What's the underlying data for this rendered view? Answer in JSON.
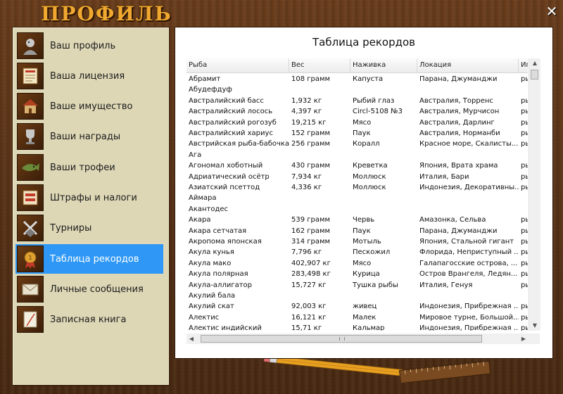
{
  "window": {
    "title": "ПРОФИЛЬ",
    "close_glyph": "✕"
  },
  "sidebar": {
    "items": [
      {
        "label": "Ваш профиль",
        "icon": "profile-icon",
        "active": false
      },
      {
        "label": "Ваша лицензия",
        "icon": "license-icon",
        "active": false
      },
      {
        "label": "Ваше имущество",
        "icon": "property-icon",
        "active": false
      },
      {
        "label": "Ваши награды",
        "icon": "awards-icon",
        "active": false
      },
      {
        "label": "Ваши трофеи",
        "icon": "trophies-icon",
        "active": false
      },
      {
        "label": "Штрафы и налоги",
        "icon": "fines-icon",
        "active": false
      },
      {
        "label": "Турниры",
        "icon": "tournaments-icon",
        "active": false
      },
      {
        "label": "Таблица рекордов",
        "icon": "records-icon",
        "active": true
      },
      {
        "label": "Личные сообщения",
        "icon": "messages-icon",
        "active": false
      },
      {
        "label": "Записная книга",
        "icon": "notebook-icon",
        "active": false
      }
    ],
    "active_color": "#2f98f6"
  },
  "records": {
    "title": "Таблица рекордов",
    "columns": [
      "Рыба",
      "Вес",
      "Наживка",
      "Локация",
      "Иг"
    ],
    "rows": [
      [
        "Абрамит",
        "108 грамм",
        "Капуста",
        "Парана, Джуманджи",
        "ры"
      ],
      [
        "Абудефдуф",
        "",
        "",
        "",
        ""
      ],
      [
        "Австралийский басс",
        "1,932 кг",
        "Рыбий глаз",
        "Австралия, Торренс",
        "ры"
      ],
      [
        "Австралийский лосось",
        "4,397 кг",
        "Circl-5108 №3",
        "Австралия, Мурчисон",
        "ры"
      ],
      [
        "Австралийский рогозуб",
        "19,215 кг",
        "Мясо",
        "Австралия, Дарлинг",
        "ры"
      ],
      [
        "Австралийский хариус",
        "152 грамм",
        "Паук",
        "Австралия, Норманби",
        "ры"
      ],
      [
        "Австрийская рыба-бабочка",
        "256 грамм",
        "Коралл",
        "Красное море, Скалисты...",
        "ры"
      ],
      [
        "Ага",
        "",
        "",
        "",
        ""
      ],
      [
        "Агономал хоботный",
        "430 грамм",
        "Креветка",
        "Япония, Врата храма",
        "ры"
      ],
      [
        "Адриатический осётр",
        "7,934 кг",
        "Моллюск",
        "Италия, Бари",
        "ры"
      ],
      [
        "Азиатский псеттод",
        "4,336 кг",
        "Моллюск",
        "Индонезия, Декоративны...",
        "ры"
      ],
      [
        "Аймара",
        "",
        "",
        "",
        ""
      ],
      [
        "Акантодес",
        "",
        "",
        "",
        ""
      ],
      [
        "Акара",
        "539 грамм",
        "Червь",
        "Амазонка, Сельва",
        "ры"
      ],
      [
        "Акара сетчатая",
        "162 грамм",
        "Паук",
        "Парана, Джуманджи",
        "ры"
      ],
      [
        "Акропома японская",
        "314 грамм",
        "Мотыль",
        "Япония, Стальной гигант",
        "ры"
      ],
      [
        "Акула кунья",
        "7,796 кг",
        "Пескожил",
        "Флорида, Неприступный ...",
        "ры"
      ],
      [
        "Акула мако",
        "402,907 кг",
        "Мясо",
        "Галапагосские острова, ...",
        "ры"
      ],
      [
        "Акула полярная",
        "283,498 кг",
        "Курица",
        "Остров Врангеля, Ледян...",
        "ры"
      ],
      [
        "Акула-аллигатор",
        "15,727 кг",
        "Тушка рыбы",
        "Италия, Генуя",
        "ры"
      ],
      [
        "Акулий бала",
        "",
        "",
        "",
        ""
      ],
      [
        "Акулий скат",
        "92,003 кг",
        "живец",
        "Индонезия, Прибрежная ...",
        "ры"
      ],
      [
        "Алектис",
        "16,121 кг",
        "Малек",
        "Мировое турне, Большой...",
        "ры"
      ],
      [
        "Алектис индийский",
        "15,71 кг",
        "Кальмар",
        "Индонезия, Прибрежная ...",
        "ры"
      ]
    ]
  }
}
